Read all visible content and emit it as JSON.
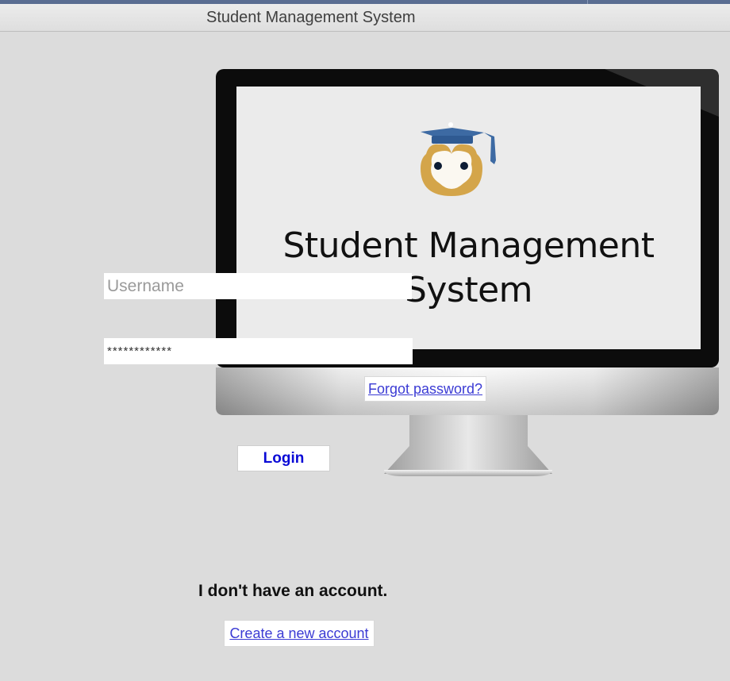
{
  "window": {
    "title": "Student Management System"
  },
  "logo": {
    "icon": "graduate-owl-icon",
    "title": "Student Management System"
  },
  "form": {
    "username": {
      "placeholder": "Username",
      "value": ""
    },
    "password": {
      "placeholder": "",
      "value": "************"
    },
    "forgot_label": "Forgot password?",
    "login_label": "Login"
  },
  "signup": {
    "prompt": "I don't have an account.",
    "create_label": "Create a new account"
  },
  "colors": {
    "background": "#dcdcdc",
    "link": "#3b3bd4",
    "login_text": "#0a0ad6",
    "cap": "#3d6aa3",
    "face": "#d4a54a"
  }
}
